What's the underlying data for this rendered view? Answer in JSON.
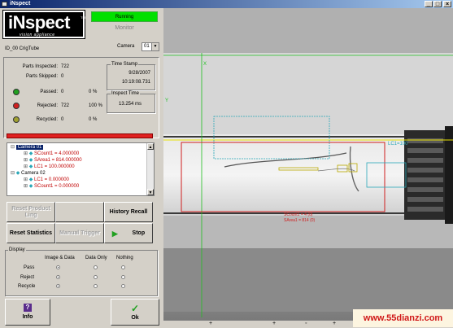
{
  "window": {
    "title": "iNspect",
    "controls": [
      "_",
      "□",
      "×"
    ]
  },
  "logo": {
    "brand": "iNspect",
    "tagline": "vision appliance",
    "tm": "TM"
  },
  "status": {
    "state": "Running",
    "mode": "Monitor"
  },
  "camera": {
    "label": "Camera",
    "selected": "01"
  },
  "job": {
    "id": "ID_00 CrigTube"
  },
  "stats": {
    "parts_inspected_label": "Parts Inspected:",
    "parts_inspected": "722",
    "parts_skipped_label": "Parts Skipped:",
    "parts_skipped": "0",
    "passed_label": "Passed:",
    "passed": "0",
    "passed_pct": "0 %",
    "rejected_label": "Rejected:",
    "rejected": "722",
    "rejected_pct": "100 %",
    "recycled_label": "Recycled:",
    "recycled": "0",
    "recycled_pct": "0 %",
    "timestamp_label": "Time Stamp",
    "date": "9/28/2007",
    "time": "10:19:08.731",
    "inspect_time_label": "Inspect Time",
    "inspect_time": "13.254 ms"
  },
  "tree": {
    "rows": [
      {
        "text": "Camera 01",
        "color": "#ffffff",
        "selected": true
      },
      {
        "text": "SCount1 = 4.000000",
        "color": "#c00000"
      },
      {
        "text": "SArea1 = 814.000000",
        "color": "#c00000"
      },
      {
        "text": "LC1 = 100.000000",
        "color": "#c00000"
      },
      {
        "text": "Camera 02",
        "color": "#000000"
      },
      {
        "text": "LC1 = 0.000000",
        "color": "#c00000"
      },
      {
        "text": "SCount1 = 0.000000",
        "color": "#c00000"
      }
    ]
  },
  "buttons": {
    "reset_product": "Reset Product Ling",
    "history_recall": "History Recall",
    "reset_statistics": "Reset Statistics",
    "manual_trigger": "Manual Trigger",
    "stop": "Stop",
    "info": "Info",
    "ok": "Ok"
  },
  "display": {
    "title": "Display",
    "col_image_data": "Image & Data",
    "col_data_only": "Data Only",
    "col_nothing": "Nothing",
    "row_pass": "Pass",
    "row_reject": "Reject",
    "row_recycle": "Recycle"
  },
  "image": {
    "roi_label": "LC1=100",
    "axis_x": "X",
    "axis_y": "Y",
    "result_line1": "SCount1 = 4 (0)",
    "result_line2": "SArea1 = 814 (0)"
  },
  "statusbar": {
    "marks": [
      "+",
      "+",
      "◦",
      "+",
      "◦",
      "◦"
    ]
  },
  "watermark": "www.55dianzi.com",
  "colors": {
    "running": "#00e000",
    "alarm": "#e02020",
    "roi_cyan": "#2aa7b8",
    "roi_yellow": "#e8e000",
    "roi_red": "#d02020",
    "roi_green": "#20c020"
  }
}
